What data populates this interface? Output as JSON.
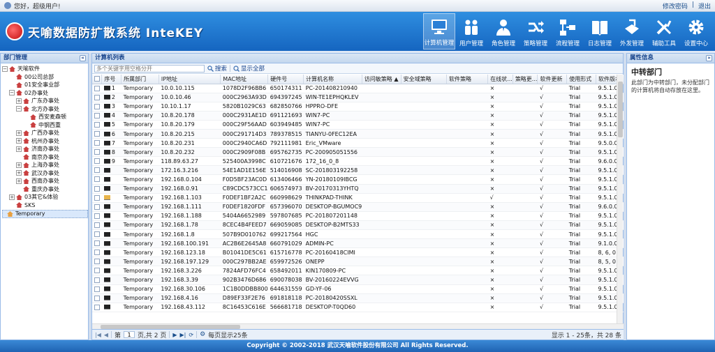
{
  "topbar": {
    "greeting": "您好，超级用户!",
    "change_password": "修改密码",
    "logout": "退出"
  },
  "header": {
    "logo_text": "天喻数据防扩散系统 InteKEY"
  },
  "nav": [
    {
      "label": "计算机管理",
      "icon": "monitor-icon",
      "active": true
    },
    {
      "label": "用户管理",
      "icon": "users-icon"
    },
    {
      "label": "角色管理",
      "icon": "roles-icon"
    },
    {
      "label": "策略管理",
      "icon": "policy-icon"
    },
    {
      "label": "流程管理",
      "icon": "workflow-icon"
    },
    {
      "label": "日志管理",
      "icon": "log-icon"
    },
    {
      "label": "外发管理",
      "icon": "outgoing-icon"
    },
    {
      "label": "辅助工具",
      "icon": "tools-icon"
    },
    {
      "label": "设置中心",
      "icon": "settings-icon"
    }
  ],
  "dept_panel": {
    "title": "部门管理",
    "tree": [
      {
        "label": "天喻软件",
        "indent": 0,
        "toggle": "−"
      },
      {
        "label": "00公司总部",
        "indent": 1,
        "toggle": ""
      },
      {
        "label": "01安全事业部",
        "indent": 1,
        "toggle": ""
      },
      {
        "label": "02办事处",
        "indent": 1,
        "toggle": "−"
      },
      {
        "label": "广东办事处",
        "indent": 2,
        "toggle": "+"
      },
      {
        "label": "北方办事处",
        "indent": 2,
        "toggle": "−"
      },
      {
        "label": "西安麦森顿",
        "indent": 3,
        "toggle": ""
      },
      {
        "label": "中钢西重",
        "indent": 3,
        "toggle": ""
      },
      {
        "label": "广西办事处",
        "indent": 2,
        "toggle": "+"
      },
      {
        "label": "杭州办事处",
        "indent": 2,
        "toggle": "+"
      },
      {
        "label": "济南办事处",
        "indent": 2,
        "toggle": "+"
      },
      {
        "label": "南京办事处",
        "indent": 2,
        "toggle": ""
      },
      {
        "label": "上海办事处",
        "indent": 2,
        "toggle": "+"
      },
      {
        "label": "武汉办事处",
        "indent": 2,
        "toggle": "+"
      },
      {
        "label": "西南办事处",
        "indent": 2,
        "toggle": "+"
      },
      {
        "label": "重庆办事处",
        "indent": 2,
        "toggle": ""
      },
      {
        "label": "03其它&体验",
        "indent": 1,
        "toggle": "+"
      },
      {
        "label": "SKS",
        "indent": 1,
        "toggle": ""
      }
    ],
    "selected": "Temporary"
  },
  "grid_panel": {
    "title": "计算机列表",
    "search_placeholder": "多个关键字用空格分开",
    "search_btn": "搜索",
    "show_all_btn": "显示全部",
    "columns": [
      "序号",
      "所属部门",
      "IP地址",
      "MAC地址",
      "硬件号",
      "计算机名称",
      "访问敏策略 ▲",
      "安全域策略",
      "软件策略",
      "在线状...",
      "策略更...",
      "软件更新",
      "使用形式",
      "软件版本"
    ],
    "rows": [
      [
        "1",
        "Temporary",
        "10.0.10.115",
        "1078D2F96BB6",
        "650174311",
        "PC-201408210940",
        "",
        "",
        "",
        "×",
        "",
        "√",
        "Trial",
        "9.5.1.0"
      ],
      [
        "2",
        "Temporary",
        "10.0.10.46",
        "000C2963A93D",
        "694397245",
        "WIN-TE1EPHQKLEV",
        "",
        "",
        "",
        "×",
        "",
        "√",
        "Trial",
        "9.5.1.0"
      ],
      [
        "3",
        "Temporary",
        "10.10.1.17",
        "5820B1029C63",
        "682850766",
        "HPPRO-DFE",
        "",
        "",
        "",
        "×",
        "",
        "√",
        "Trial",
        "9.5.1.0"
      ],
      [
        "4",
        "Temporary",
        "10.8.20.178",
        "000C2931AE1D",
        "691121693",
        "WIN7-PC",
        "",
        "",
        "",
        "×",
        "",
        "√",
        "Trial",
        "9.5.1.0"
      ],
      [
        "5",
        "Temporary",
        "10.8.20.179",
        "000C29F56AAD",
        "603949485",
        "WIN7-PC",
        "",
        "",
        "",
        "×",
        "",
        "√",
        "Trial",
        "9.5.1.0"
      ],
      [
        "6",
        "Temporary",
        "10.8.20.215",
        "000C291714D3",
        "789378515",
        "TIANYU-0FEC12EA",
        "",
        "",
        "",
        "×",
        "",
        "√",
        "Trial",
        "9.5.1.0"
      ],
      [
        "7",
        "Temporary",
        "10.8.20.231",
        "000C2940CA6D",
        "792111981",
        "Eric_VMware",
        "",
        "",
        "",
        "×",
        "",
        "√",
        "Trial",
        "9.5.0.0"
      ],
      [
        "8",
        "Temporary",
        "10.8.20.232",
        "000C2909F08B",
        "695762735",
        "PC-200905051556",
        "",
        "",
        "",
        "×",
        "",
        "√",
        "Trial",
        "9.5.1.0"
      ],
      [
        "9",
        "Temporary",
        "118.89.63.27",
        "525400A3998C",
        "610721676",
        "172_16_0_8",
        "",
        "",
        "",
        "×",
        "",
        "√",
        "Trial",
        "9.6.0.0"
      ],
      [
        "",
        "Temporary",
        "172.16.3.216",
        "54E1AD1E156E",
        "514016908",
        "SC-201803192258",
        "",
        "",
        "",
        "×",
        "",
        "√",
        "Trial",
        "9.5.1.0"
      ],
      [
        "",
        "Temporary",
        "192.168.0.104",
        "F0D5BF23AC0D",
        "613406466",
        "YN-20180109IBCG",
        "",
        "",
        "",
        "×",
        "",
        "√",
        "Trial",
        "9.5.1.0"
      ],
      [
        "",
        "Temporary",
        "192.168.0.91",
        "C89CDC573CC1",
        "606574973",
        "BV-20170313YHTQ",
        "",
        "",
        "",
        "×",
        "",
        "√",
        "Trial",
        "9.5.1.0"
      ],
      [
        "",
        "Temporary",
        "192.168.1.103",
        "F0DEF1BF2A2C",
        "660998629",
        "THINKPAD-THINK",
        "",
        "",
        "",
        "√",
        "",
        "√",
        "Trial",
        "9.5.1.0"
      ],
      [
        "",
        "Temporary",
        "192.168.1.111",
        "F0DEF1820FDF",
        "657396070",
        "DESKTOP-BGUMOC9",
        "",
        "",
        "",
        "×",
        "",
        "√",
        "Trial",
        "9.6.0.0"
      ],
      [
        "",
        "Temporary",
        "192.168.1.188",
        "5404A6652989",
        "597807685",
        "PC-201807201148",
        "",
        "",
        "",
        "×",
        "",
        "√",
        "Trial",
        "9.5.1.0"
      ],
      [
        "",
        "Temporary",
        "192.168.1.78",
        "8CEC4B4FEED7",
        "669059085",
        "DESKTOP-B2MTS33",
        "",
        "",
        "",
        "×",
        "",
        "√",
        "Trial",
        "9.5.1.0"
      ],
      [
        "",
        "Temporary",
        "192.168.1.8",
        "507B9D010762",
        "699217564",
        "HGC",
        "",
        "",
        "",
        "×",
        "",
        "√",
        "Trial",
        "9.5.1.0"
      ],
      [
        "",
        "Temporary",
        "192.168.100.191",
        "AC2B6E2645A8",
        "660791029",
        "ADMIN-PC",
        "",
        "",
        "",
        "×",
        "",
        "√",
        "Trial",
        "9.1.0.0"
      ],
      [
        "",
        "Temporary",
        "192.168.123.18",
        "B01041DE5C61",
        "615716778",
        "PC-20160418CIMI",
        "",
        "",
        "",
        "×",
        "",
        "√",
        "Trial",
        "8, 6, 0"
      ],
      [
        "",
        "Temporary",
        "192.168.197.129",
        "000C297BB2AE",
        "659972526",
        "ONEPP",
        "",
        "",
        "",
        "×",
        "",
        "√",
        "Trial",
        "8, 5, 0"
      ],
      [
        "",
        "Temporary",
        "192.168.3.226",
        "7824AFD76FC4",
        "658492011",
        "KIN170809-PC",
        "",
        "",
        "",
        "×",
        "",
        "√",
        "Trial",
        "9.5.1.0"
      ],
      [
        "",
        "Temporary",
        "192.168.3.39",
        "902B3476D686",
        "690078038",
        "BV-20160224EVVG",
        "",
        "",
        "",
        "×",
        "",
        "√",
        "Trial",
        "9.5.1.0"
      ],
      [
        "",
        "Temporary",
        "192.168.30.106",
        "1C1B0DDBB800",
        "644631559",
        "GD-YF-06",
        "",
        "",
        "",
        "×",
        "",
        "√",
        "Trial",
        "9.5.1.0"
      ],
      [
        "",
        "Temporary",
        "192.168.4.16",
        "D89EF33F2E76",
        "691818118",
        "PC-20180420SSXL",
        "",
        "",
        "",
        "×",
        "",
        "√",
        "Trial",
        "9.5.1.0"
      ],
      [
        "",
        "Temporary",
        "192.168.43.112",
        "8C16453C616E",
        "566681718",
        "DESKTOP-T0QD60",
        "",
        "",
        "",
        "×",
        "",
        "√",
        "Trial",
        "9.5.1.0"
      ]
    ],
    "pager": {
      "page_label": "第",
      "page_value": "1",
      "total_pages": "页,共 2 页",
      "page_size_label": "每页显示25条",
      "summary": "显示 1 - 25条，共 28 条"
    }
  },
  "prop_panel": {
    "title": "属性信息",
    "heading": "中转部门",
    "description": "此部门为中转部门，未分配部门的计算机将自动存放在这里。"
  },
  "footer": {
    "text": "Copyright © 2002-2018 武汉天喻软件股份有限公司 All Rights Reserved."
  }
}
